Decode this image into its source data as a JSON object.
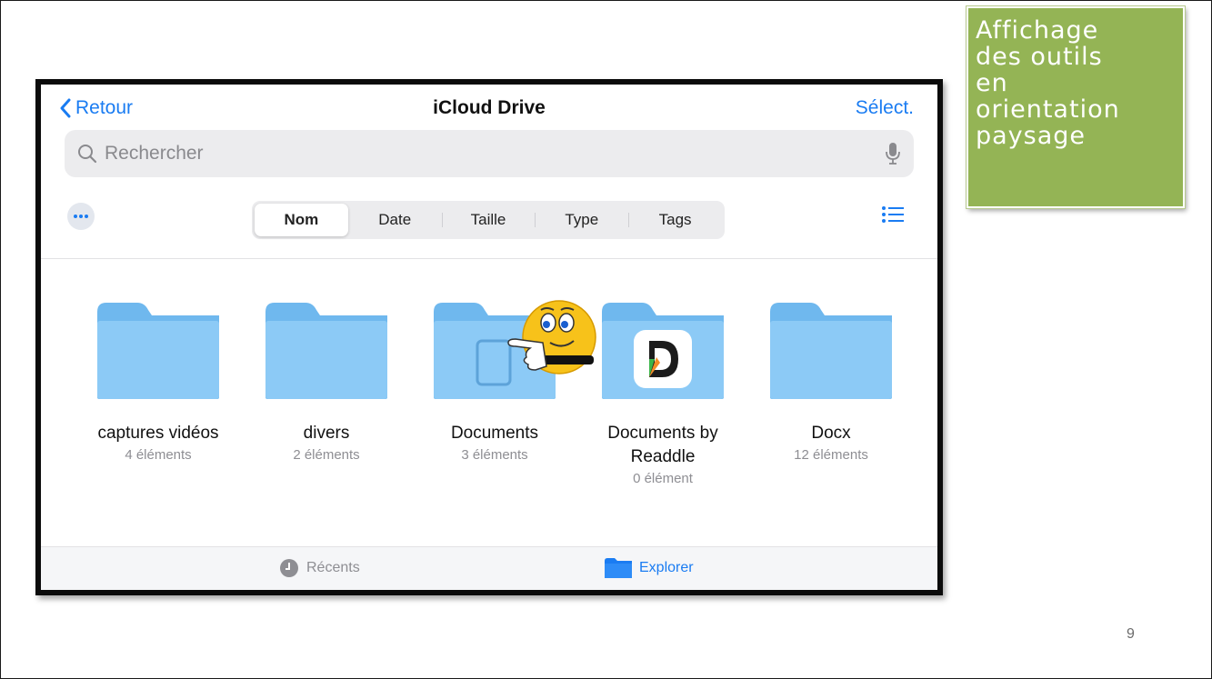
{
  "callout": {
    "lines": [
      "Affichage",
      "des outils",
      "en",
      "orientation",
      "paysage"
    ],
    "background": "#94b455"
  },
  "page_number": "9",
  "nav": {
    "back_label": "Retour",
    "title": "iCloud Drive",
    "select_label": "Sélect."
  },
  "search": {
    "placeholder": "Rechercher"
  },
  "sort_tabs": [
    "Nom",
    "Date",
    "Taille",
    "Type",
    "Tags"
  ],
  "sort_active": "Nom",
  "folders": [
    {
      "name": "captures vidéos",
      "count": "4 éléments"
    },
    {
      "name": "divers",
      "count": "2 éléments"
    },
    {
      "name": "Documents",
      "count": "3 éléments"
    },
    {
      "name": "Documents by Readdle",
      "count": "0 élément"
    },
    {
      "name": "Docx",
      "count": "12 éléments"
    }
  ],
  "tab_bar": {
    "recents_label": "Récents",
    "explorer_label": "Explorer"
  },
  "colors": {
    "accent": "#1a7cf2",
    "folder": "#8ccaf6",
    "folder_tab": "#6fb8ee"
  },
  "icons": [
    "chevron-left-icon",
    "search-icon",
    "microphone-icon",
    "more-icon",
    "list-icon",
    "clock-icon",
    "folder-icon",
    "readdle-app-icon",
    "pointing-smiley-emoji"
  ]
}
